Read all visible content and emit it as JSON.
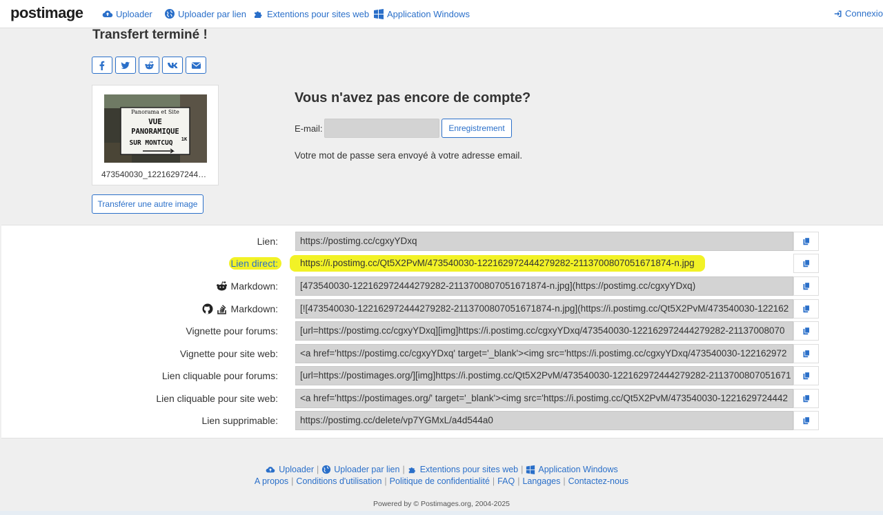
{
  "nav": {
    "logo": "postimage",
    "uploader": "Uploader",
    "uploader_link": "Uploader par lien",
    "extensions": "Extentions pour sites web",
    "windows_app": "Application Windows",
    "login": "Connexion"
  },
  "upload": {
    "title": "Transfert terminé !",
    "share_icons": [
      "facebook-icon",
      "twitter-icon",
      "reddit-icon",
      "vk-icon",
      "email-icon"
    ],
    "filename": "473540030_12216297244…",
    "thumbnail_text": [
      "Panorama et Site",
      "VUE",
      "PANORAMIQUE",
      "SUR MONTCUQ",
      "1K"
    ],
    "another_button": "Transférer une autre image"
  },
  "account": {
    "title": "Vous n'avez pas encore de compte?",
    "email_label": "E-mail:",
    "email_value": "",
    "register_button": "Enregistrement",
    "password_note": "Votre mot de passe sera envoyé à votre adresse email."
  },
  "links": [
    {
      "label": "Lien:",
      "value": "https://postimg.cc/cgxyYDxq"
    },
    {
      "label": "Lien direct:",
      "value": "https://i.postimg.cc/Qt5X2PvM/473540030-122162972444279282-2113700807051671874-n.jpg"
    },
    {
      "label": "Markdown:",
      "value": "[473540030-122162972444279282-2113700807051671874-n.jpg](https://postimg.cc/cgxyYDxq)"
    },
    {
      "label": "Markdown:",
      "value": "[![473540030-122162972444279282-2113700807051671874-n.jpg](https://i.postimg.cc/Qt5X2PvM/473540030-122162"
    },
    {
      "label": "Vignette pour forums:",
      "value": "[url=https://postimg.cc/cgxyYDxq][img]https://i.postimg.cc/cgxyYDxq/473540030-122162972444279282-21137008070"
    },
    {
      "label": "Vignette pour site web:",
      "value": "<a href='https://postimg.cc/cgxyYDxq' target='_blank'><img src='https://i.postimg.cc/cgxyYDxq/473540030-122162972"
    },
    {
      "label": "Lien cliquable pour forums:",
      "value": "[url=https://postimages.org/][img]https://i.postimg.cc/Qt5X2PvM/473540030-122162972444279282-2113700807051671"
    },
    {
      "label": "Lien cliquable pour site web:",
      "value": "<a href='https://postimages.org/' target='_blank'><img src='https://i.postimg.cc/Qt5X2PvM/473540030-1221629724442"
    },
    {
      "label": "Lien supprimable:",
      "value": "https://postimg.cc/delete/vp7YGMxL/a4d544a0"
    }
  ],
  "footer": {
    "uploader": "Uploader",
    "uploader_link": "Uploader par lien",
    "extensions": "Extentions pour sites web",
    "windows_app": "Application Windows",
    "about": "A propos",
    "terms": "Conditions d'utilisation",
    "privacy": "Politique de confidentialité",
    "faq": "FAQ",
    "languages": "Langages",
    "contact": "Contactez-nous",
    "powered": "Powered by © Postimages.org, 2004-2025"
  },
  "colors": {
    "accent": "#2a6fc9",
    "highlight": "#f0f000",
    "field_bg": "#d3d3d3"
  }
}
